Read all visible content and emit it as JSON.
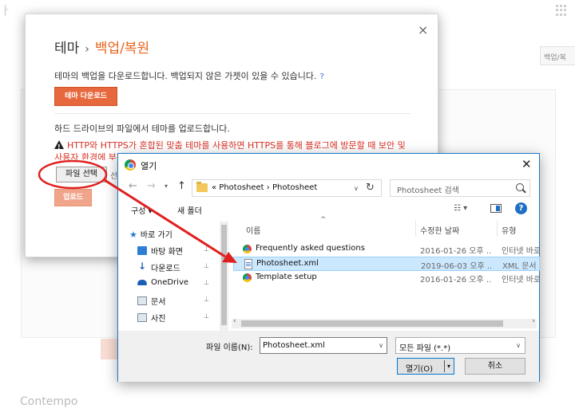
{
  "background": {
    "corner_text": "ㅏ",
    "backup_button_label": "백업/복",
    "side_ghost_label": "",
    "footer_theme_name": "Contempo"
  },
  "theme_dialog": {
    "title_main": "테마",
    "title_separator": "›",
    "title_sub": "백업/복원",
    "close_glyph": "×",
    "backup_description": "테마의 백업을 다운로드합니다. 백업되지 않은 가젯이 있을 수 있습니다.",
    "help_glyph": "?",
    "download_button": "테마 다운로드",
    "upload_description": "하드 드라이브의 파일에서 테마를 업로드합니다.",
    "warning_text": "HTTP와 HTTPS가 혼합된 맞춤 테마를 사용하면 HTTPS를 통해 블로그에 방문할 때 보안 및 사용자 환경에 부정적인 영향을 줄 수 있습니다.",
    "file_select_button": "파일 선택",
    "file_status_fragment": "선",
    "upload_button": "업로드"
  },
  "open_dialog": {
    "title": "열기",
    "close_glyph": "✕",
    "nav": {
      "back": "←",
      "forward": "→",
      "dropdown": "▾",
      "up": "↑"
    },
    "address": {
      "path_text": "«  Photosheet  ›  Photosheet",
      "dropdown": "∨",
      "refresh": "↻"
    },
    "search_placeholder": "Photosheet 검색",
    "toolbar": {
      "organize": "구성 ▾",
      "new_folder": "새 폴더",
      "view": "☷ ▾",
      "help": "?"
    },
    "nav_pane": [
      {
        "label": "바로 가기",
        "icon": "quick-access-icon",
        "pinned": false
      },
      {
        "label": "바탕 화면",
        "icon": "desktop-icon",
        "pinned": true
      },
      {
        "label": "다운로드",
        "icon": "download-icon",
        "pinned": true
      },
      {
        "label": "OneDrive",
        "icon": "onedrive-icon",
        "pinned": true
      },
      {
        "label": "문서",
        "icon": "documents-icon",
        "pinned": true
      },
      {
        "label": "사진",
        "icon": "pictures-icon",
        "pinned": true
      }
    ],
    "pin_glyph": "📌",
    "columns": {
      "name": "이름",
      "sort_glyph": "^",
      "modified": "수정한 날짜",
      "type": "유형"
    },
    "files": [
      {
        "name": "Frequently asked questions",
        "date": "2016-01-26 오후 ...",
        "type": "인터넷 바로 가기",
        "icon": "chrome-shortcut-icon",
        "selected": false
      },
      {
        "name": "Photosheet.xml",
        "date": "2019-06-03 오후 ...",
        "type": "XML 문서",
        "icon": "xml-file-icon",
        "selected": true
      },
      {
        "name": "Template setup",
        "date": "2016-01-26 오후 ...",
        "type": "인터넷 바로 가기",
        "icon": "chrome-shortcut-icon",
        "selected": false
      }
    ],
    "footer": {
      "filename_label": "파일 이름(N):",
      "filename_value": "Photosheet.xml",
      "filetype_value": "모든 파일 (*.*)",
      "open_button": "열기(O)",
      "cancel_button": "취소",
      "dropdown": "∨",
      "split_dropdown": "▾"
    }
  },
  "colors": {
    "accent_orange": "#e8641b",
    "warning_red": "#d93025",
    "annotation_red": "#e02020",
    "selection_blue": "#cce8ff",
    "windows_blue": "#0078d7"
  }
}
